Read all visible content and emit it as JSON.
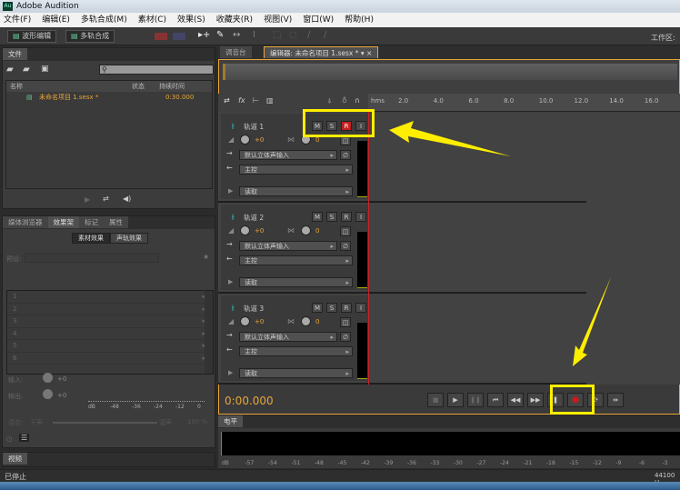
{
  "app": {
    "title": "Adobe Audition",
    "logo": "Au"
  },
  "menu": [
    "文件(F)",
    "编辑(E)",
    "多轨合成(M)",
    "素材(C)",
    "效果(S)",
    "收藏夹(R)",
    "视图(V)",
    "窗口(W)",
    "帮助(H)"
  ],
  "toolbar": {
    "waveform": "波形编辑",
    "multitrack": "多轨合成",
    "workspace": "工作区:"
  },
  "files": {
    "tab": "文件",
    "columns": [
      "名称",
      "状态",
      "持续时间"
    ],
    "items": [
      {
        "name": "未命名项目 1.sesx *",
        "duration": "0:30.000"
      }
    ]
  },
  "effects": {
    "tabs": [
      "媒体浏览器",
      "效果架",
      "标记",
      "属性"
    ],
    "subtabs": [
      "素材效果",
      "声轨效果"
    ],
    "preset_label": "预设:",
    "slots": [
      "1",
      "2",
      "3",
      "4",
      "5",
      "6"
    ],
    "input": "输入:",
    "output": "输出:",
    "input_val": "+0",
    "output_val": "+0",
    "scale": [
      "dB",
      "-48",
      "-36",
      "-24",
      "-12",
      "0"
    ],
    "mix": "混合:",
    "dry": "干声",
    "wet": "湿声",
    "mix_val": "100 %"
  },
  "video": {
    "tab": "视频"
  },
  "editor": {
    "tabs": [
      "调音台",
      "编辑器: 未命名项目 1.sesx *"
    ],
    "ruler": [
      "hms",
      "2.0",
      "4.0",
      "6.0",
      "8.0",
      "10.0",
      "12.0",
      "14.0",
      "16.0"
    ],
    "tracks": [
      {
        "name": "轨道 1",
        "vol": "+0",
        "pan": "0",
        "input": "默认立体声输入",
        "output": "主控",
        "mode": "读取",
        "rec": true
      },
      {
        "name": "轨道 2",
        "vol": "+0",
        "pan": "0",
        "input": "默认立体声输入",
        "output": "主控",
        "mode": "读取",
        "rec": false
      },
      {
        "name": "轨道 3",
        "vol": "+0",
        "pan": "0",
        "input": "默认立体声输入",
        "output": "主控",
        "mode": "读取",
        "rec": false
      }
    ],
    "buttons": [
      "M",
      "S",
      "R",
      "I"
    ],
    "time": "0:00.000"
  },
  "levels": {
    "tab": "电平",
    "scale": [
      "dB",
      "-57",
      "-54",
      "-51",
      "-48",
      "-45",
      "-42",
      "-39",
      "-36",
      "-33",
      "-30",
      "-27",
      "-24",
      "-21",
      "-18",
      "-15",
      "-12",
      "-9",
      "-6",
      "-3"
    ]
  },
  "status": {
    "left": "已停止",
    "right": "44100 H"
  },
  "colors": {
    "accent": "#e8a53a",
    "highlight": "#ffee00",
    "record": "#d01818"
  }
}
